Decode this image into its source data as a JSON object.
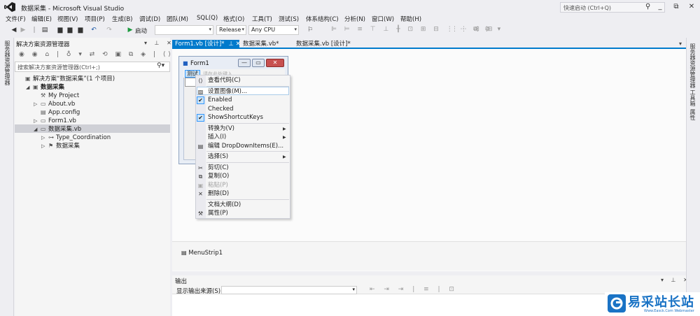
{
  "window": {
    "title": "数据采集 - Microsoft Visual Studio",
    "quick_launch_placeholder": "快速启动 (Ctrl+Q)"
  },
  "menubar": [
    "文件(F)",
    "编辑(E)",
    "视图(V)",
    "项目(P)",
    "生成(B)",
    "调试(D)",
    "团队(M)",
    "SQL(Q)",
    "格式(O)",
    "工具(T)",
    "测试(S)",
    "体系结构(C)",
    "分析(N)",
    "窗口(W)",
    "帮助(H)"
  ],
  "toolbar": {
    "start_label": "启动",
    "start_combo_value": "",
    "config_value": "Release",
    "platform_value": "Any CPU"
  },
  "left_strip_label": "服务器资源管理器",
  "solution_explorer": {
    "title": "解决方案资源管理器",
    "search_placeholder": "搜索解决方案资源管理器(Ctrl+;)",
    "tree": [
      {
        "label": "解决方案“数据采集”(1 个项目)",
        "indent": 0,
        "toggle": "",
        "icon": "solution-icon",
        "bold": false
      },
      {
        "label": "数据采集",
        "indent": 1,
        "toggle": "◢",
        "icon": "vb-project-icon",
        "bold": true
      },
      {
        "label": "My Project",
        "indent": 2,
        "toggle": "",
        "icon": "wrench-icon",
        "bold": false
      },
      {
        "label": "About.vb",
        "indent": 2,
        "toggle": "▷",
        "icon": "form-file-icon",
        "bold": false
      },
      {
        "label": "App.config",
        "indent": 2,
        "toggle": "",
        "icon": "config-file-icon",
        "bold": false
      },
      {
        "label": "Form1.vb",
        "indent": 2,
        "toggle": "▷",
        "icon": "form-file-icon",
        "bold": false
      },
      {
        "label": "数据采集.vb",
        "indent": 2,
        "toggle": "◢",
        "icon": "form-file-icon",
        "bold": false
      },
      {
        "label": "Type_Coordination",
        "indent": 3,
        "toggle": "▷",
        "icon": "enum-icon",
        "bold": false
      },
      {
        "label": "数据采集",
        "indent": 3,
        "toggle": "▷",
        "icon": "class-icon",
        "bold": false
      }
    ]
  },
  "tabs": [
    {
      "label": "Form1.vb [设计]*",
      "active": true
    },
    {
      "label": "数据采集.vb*",
      "active": false
    },
    {
      "label": "数据采集.vb [设计]*",
      "active": false
    }
  ],
  "form1": {
    "title": "Form1",
    "menu_item": "测试",
    "type_here": "请在此处键入"
  },
  "context_menu": [
    {
      "label": "查看代码(C)",
      "icon": "view-code-icon",
      "checked": false,
      "submenu": false,
      "disabled": false
    },
    {
      "sep": true
    },
    {
      "label": "设置图像(M)...",
      "icon": "image-icon",
      "checked": false,
      "submenu": false,
      "disabled": false
    },
    {
      "label": "Enabled",
      "icon": "",
      "checked": true,
      "submenu": false,
      "disabled": false
    },
    {
      "label": "Checked",
      "icon": "",
      "checked": false,
      "submenu": false,
      "disabled": false
    },
    {
      "label": "ShowShortcutKeys",
      "icon": "",
      "checked": true,
      "submenu": false,
      "disabled": false
    },
    {
      "sep": true
    },
    {
      "label": "转换为(V)",
      "icon": "",
      "checked": false,
      "submenu": true,
      "disabled": false
    },
    {
      "label": "插入(I)",
      "icon": "",
      "checked": false,
      "submenu": true,
      "disabled": false
    },
    {
      "label": "编辑 DropDownItems(E)...",
      "icon": "edit-items-icon",
      "checked": false,
      "submenu": false,
      "disabled": false
    },
    {
      "sep": true
    },
    {
      "label": "选择(S)",
      "icon": "",
      "checked": false,
      "submenu": true,
      "disabled": false
    },
    {
      "sep": true
    },
    {
      "label": "剪切(C)",
      "icon": "cut-icon",
      "checked": false,
      "submenu": false,
      "disabled": false
    },
    {
      "label": "复制(O)",
      "icon": "copy-icon",
      "checked": false,
      "submenu": false,
      "disabled": false
    },
    {
      "label": "粘贴(P)",
      "icon": "paste-icon",
      "checked": false,
      "submenu": false,
      "disabled": true
    },
    {
      "label": "删除(D)",
      "icon": "delete-icon",
      "checked": false,
      "submenu": false,
      "disabled": false
    },
    {
      "sep": true
    },
    {
      "label": "文档大纲(D)",
      "icon": "",
      "checked": false,
      "submenu": false,
      "disabled": false
    },
    {
      "label": "属性(P)",
      "icon": "properties-icon",
      "checked": false,
      "submenu": false,
      "disabled": false
    }
  ],
  "tray": {
    "component": "MenuStrip1"
  },
  "output": {
    "title": "输出",
    "show_from_label": "显示输出来源(S):",
    "show_from_value": ""
  },
  "right_strip": [
    "服务器资源管理器",
    "工具箱",
    "属性"
  ],
  "watermark": {
    "text": "易采站长站",
    "sub": "Www.Easck.Com Webmaster"
  },
  "colors": {
    "accent": "#007acc",
    "watermark": "#1a73c5"
  }
}
